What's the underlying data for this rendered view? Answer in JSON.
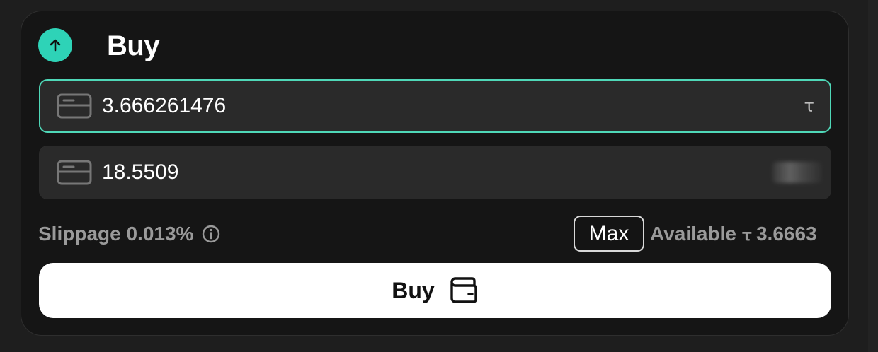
{
  "colors": {
    "accent": "#2ed3b7",
    "panel_bg": "#151515",
    "field_bg": "#2a2a2a",
    "active_border": "#4fd8b8",
    "muted_text": "#9a9a9a",
    "button_bg": "#ffffff"
  },
  "header": {
    "title": "Buy",
    "icon": "arrow-up-icon"
  },
  "pay_field": {
    "value": "3.666261476",
    "icon": "card-icon",
    "currency_symbol": "τ"
  },
  "receive_field": {
    "value": "18.5509",
    "icon": "card-icon",
    "token_icon": "token-icon"
  },
  "slippage": {
    "text": "Slippage 0.013%",
    "icon": "info-icon"
  },
  "max_button": {
    "label": "Max"
  },
  "available": {
    "label": "Available",
    "symbol": "τ",
    "amount": "3.6663"
  },
  "buy_button": {
    "label": "Buy",
    "icon": "wallet-icon"
  }
}
